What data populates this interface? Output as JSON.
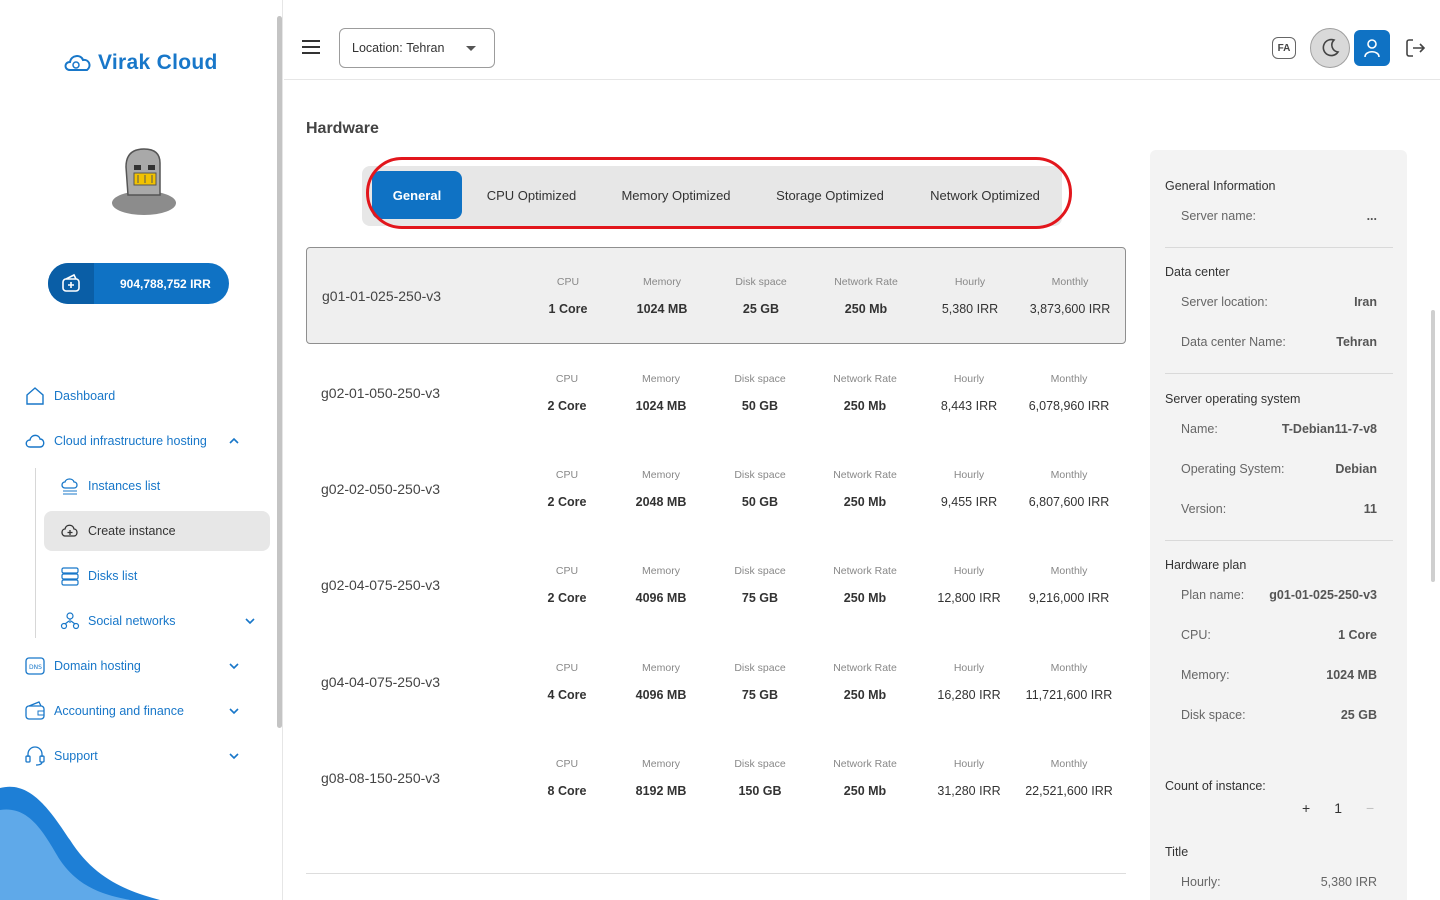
{
  "brand": {
    "name": "Virak Cloud"
  },
  "balance": {
    "amount": "904,788,752 IRR"
  },
  "colors": {
    "primary": "#0f72c4",
    "highlight": "#e2161c"
  },
  "nav": {
    "dashboard": "Dashboard",
    "cloud": "Cloud infrastructure hosting",
    "instances": "Instances list",
    "create": "Create instance",
    "disks": "Disks list",
    "social": "Social networks",
    "domain": "Domain hosting",
    "accounting": "Accounting and finance",
    "support": "Support"
  },
  "header": {
    "location_label": "Location:",
    "location_value": "Tehran",
    "lang": "FA"
  },
  "main": {
    "title": "Hardware",
    "tabs": [
      "General",
      "CPU Optimized",
      "Memory Optimized",
      "Storage Optimized",
      "Network Optimized"
    ],
    "headers": {
      "cpu": "CPU",
      "memory": "Memory",
      "disk": "Disk space",
      "net": "Network Rate",
      "hourly": "Hourly",
      "monthly": "Monthly"
    },
    "currency": "IRR",
    "plans": [
      {
        "name": "g01-01-025-250-v3",
        "cpu": "1 Core",
        "memory": "1024 MB",
        "disk": "25 GB",
        "net": "250 Mb",
        "hourly": "5,380",
        "monthly": "3,873,600"
      },
      {
        "name": "g02-01-050-250-v3",
        "cpu": "2 Core",
        "memory": "1024 MB",
        "disk": "50 GB",
        "net": "250 Mb",
        "hourly": "8,443",
        "monthly": "6,078,960"
      },
      {
        "name": "g02-02-050-250-v3",
        "cpu": "2 Core",
        "memory": "2048 MB",
        "disk": "50 GB",
        "net": "250 Mb",
        "hourly": "9,455",
        "monthly": "6,807,600"
      },
      {
        "name": "g02-04-075-250-v3",
        "cpu": "2 Core",
        "memory": "4096 MB",
        "disk": "75 GB",
        "net": "250 Mb",
        "hourly": "12,800",
        "monthly": "9,216,000"
      },
      {
        "name": "g04-04-075-250-v3",
        "cpu": "4 Core",
        "memory": "4096 MB",
        "disk": "75 GB",
        "net": "250 Mb",
        "hourly": "16,280",
        "monthly": "11,721,600"
      },
      {
        "name": "g08-08-150-250-v3",
        "cpu": "8 Core",
        "memory": "8192 MB",
        "disk": "150 GB",
        "net": "250 Mb",
        "hourly": "31,280",
        "monthly": "22,521,600"
      }
    ]
  },
  "summary": {
    "general_title": "General Information",
    "server_name_label": "Server name:",
    "server_name_value": "...",
    "dc_title": "Data center",
    "location_label": "Server location:",
    "location_value": "Iran",
    "dc_name_label": "Data center Name:",
    "dc_name_value": "Tehran",
    "os_title": "Server operating system",
    "os_name_label": "Name:",
    "os_name_value": "T-Debian11-7-v8",
    "os_label": "Operating System:",
    "os_value": "Debian",
    "version_label": "Version:",
    "version_value": "11",
    "hw_title": "Hardware plan",
    "plan_label": "Plan name:",
    "plan_value": "g01-01-025-250-v3",
    "cpu_label": "CPU:",
    "cpu_value": "1 Core",
    "memory_label": "Memory:",
    "memory_value": "1024 MB",
    "disk_label": "Disk space:",
    "disk_value": "25 GB",
    "count_title": "Count of instance:",
    "count_value": "1",
    "plus": "+",
    "minus": "−",
    "title_label": "Title",
    "hourly_label": "Hourly:",
    "hourly_value": "5,380 IRR"
  }
}
